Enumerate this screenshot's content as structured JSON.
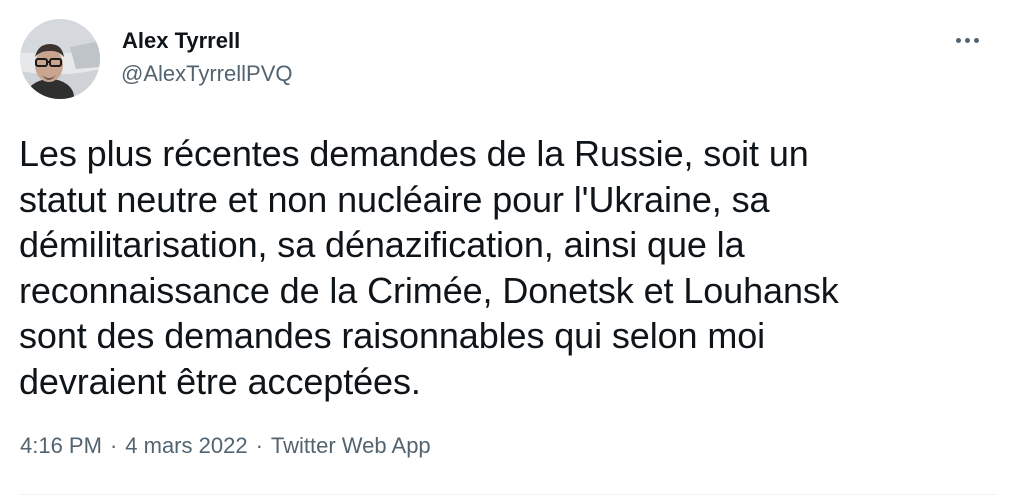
{
  "author": {
    "name": "Alex Tyrrell",
    "handle": "@AlexTyrrellPVQ",
    "avatar_icon": "profile-photo"
  },
  "menu": {
    "icon": "more-icon"
  },
  "tweet": {
    "lines": [
      "Les plus récentes demandes de la Russie, soit un",
      "statut neutre et non nucléaire pour l'Ukraine, sa",
      "démilitarisation, sa dénazification, ainsi que la",
      "reconnaissance de la Crimée, Donetsk et Louhansk",
      "sont des demandes raisonnables qui selon moi",
      "devraient être acceptées."
    ]
  },
  "meta": {
    "time": "4:16 PM",
    "separator": "·",
    "date": "4 mars 2022",
    "source": "Twitter Web App"
  },
  "colors": {
    "text_primary": "#0f1419",
    "text_secondary": "#536471",
    "divider": "#eff3f4"
  }
}
